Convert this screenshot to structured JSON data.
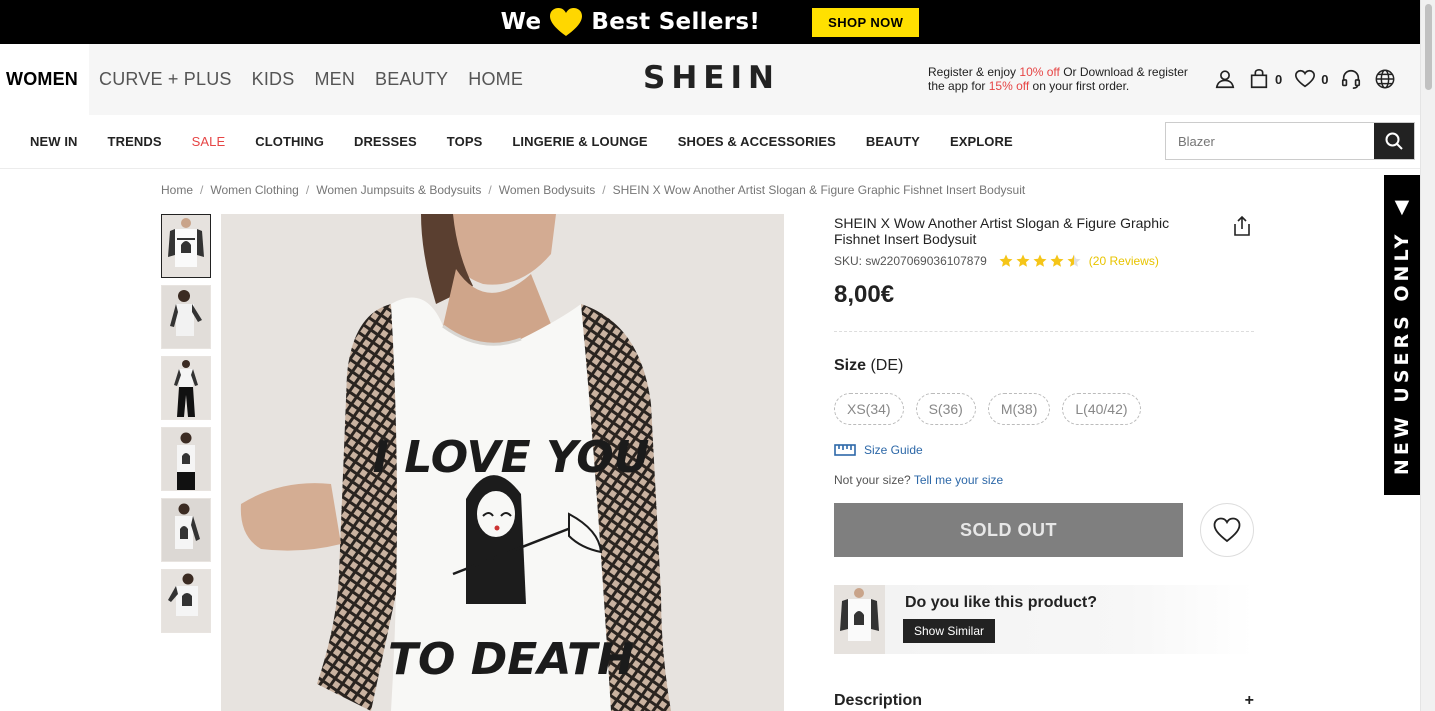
{
  "promo_bar": {
    "text_before": "We",
    "text_after": "Best Sellers!",
    "button_label": "SHOP NOW",
    "heart_color": "#ffd700"
  },
  "header": {
    "category_tabs": [
      "WOMEN",
      "CURVE + PLUS",
      "KIDS",
      "MEN",
      "BEAUTY",
      "HOME"
    ],
    "logo": "SHEIN",
    "promo_note": {
      "line1_prefix": "Register & enjoy ",
      "line1_highlight": "10% off",
      "line1_suffix": " Or Download & register",
      "line2_prefix": "the app for ",
      "line2_highlight": "15% off",
      "line2_suffix": " on your first order."
    },
    "cart_count": "0",
    "wishlist_count": "0",
    "icons": [
      "user-icon",
      "bag-icon",
      "heart-icon",
      "headset-icon",
      "globe-icon"
    ]
  },
  "nav": {
    "items": [
      "NEW IN",
      "TRENDS",
      "SALE",
      "CLOTHING",
      "DRESSES",
      "TOPS",
      "LINGERIE & LOUNGE",
      "SHOES & ACCESSORIES",
      "BEAUTY",
      "EXPLORE"
    ],
    "search_placeholder": "Blazer"
  },
  "breadcrumb": [
    "Home",
    "Women Clothing",
    "Women Jumpsuits & Bodysuits",
    "Women Bodysuits",
    "SHEIN X Wow Another Artist Slogan & Figure Graphic Fishnet Insert Bodysuit"
  ],
  "product": {
    "title": "SHEIN X Wow Another Artist Slogan & Figure Graphic Fishnet Insert Bodysuit",
    "sku": "SKU: sw2207069036107879",
    "rating": 4.5,
    "reviews": "(20 Reviews)",
    "price": "8,00€",
    "size_label": "Size",
    "size_region": "(DE)",
    "sizes": [
      "XS(34)",
      "S(36)",
      "M(38)",
      "L(40/42)"
    ],
    "size_guide": "Size Guide",
    "not_size_prefix": "Not your size?",
    "not_size_link": "Tell me your size",
    "sold_out": "SOLD OUT",
    "similar_question": "Do you like this product?",
    "similar_button": "Show Similar",
    "description_label": "Description",
    "description_toggle": "+",
    "shirt_print_top": "I LOVE YOU",
    "shirt_print_bottom": "TO DEATH"
  },
  "side_tab": "NEW USERS ONLY"
}
